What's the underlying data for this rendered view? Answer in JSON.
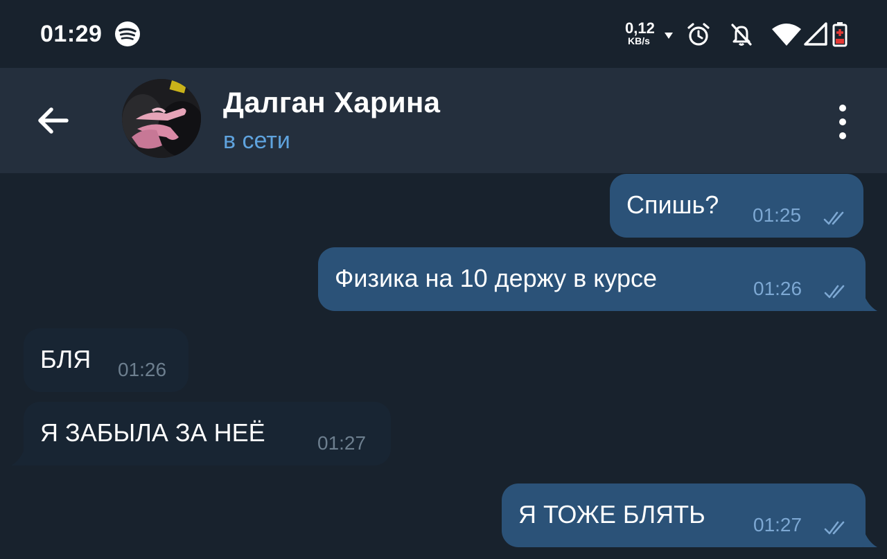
{
  "status_bar": {
    "time": "01:29",
    "net_speed_value": "0,12",
    "net_speed_unit": "KB/s",
    "icons": [
      "spotify-icon",
      "download-arrow-icon",
      "alarm-icon",
      "notifications-off-icon",
      "wifi-icon",
      "signal-icon",
      "battery-low-icon"
    ]
  },
  "header": {
    "back_icon": "arrow-left-icon",
    "contact_name": "Далган Харина",
    "status": "в сети",
    "menu_icon": "more-vertical-icon"
  },
  "messages": [
    {
      "direction": "out",
      "text": "Спишь?",
      "time": "01:25",
      "read": true
    },
    {
      "direction": "out",
      "text": "Физика на 10 держу в курсе",
      "time": "01:26",
      "read": true
    },
    {
      "direction": "in",
      "text": "БЛЯ",
      "time": "01:26"
    },
    {
      "direction": "in",
      "text": "Я ЗАБЫЛА ЗА НЕЁ",
      "time": "01:27"
    },
    {
      "direction": "out",
      "text": "Я ТОЖЕ БЛЯТЬ",
      "time": "01:27",
      "read": true
    }
  ],
  "colors": {
    "background": "#18222d",
    "header": "#242f3d",
    "outgoing_bubble": "#2b5278",
    "incoming_bubble": "#182533",
    "online_status": "#5fa3de",
    "battery_low": "#e53935"
  }
}
